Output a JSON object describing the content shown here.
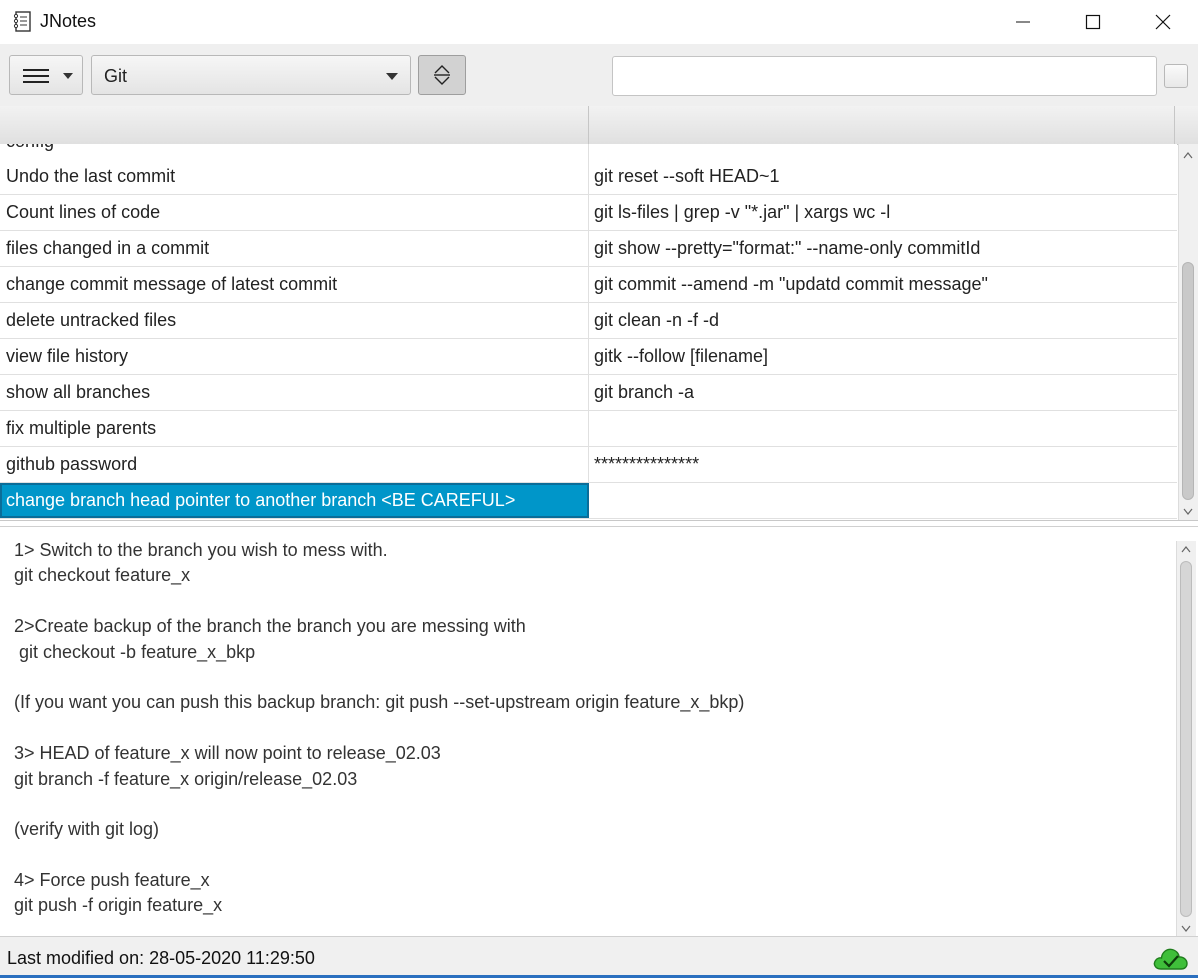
{
  "window": {
    "title": "JNotes",
    "icons": {
      "app": "notebook-icon",
      "minimize": "minimize-icon",
      "maximize": "maximize-icon",
      "close": "close-icon"
    }
  },
  "toolbar": {
    "menu_icon": "hamburger-icon",
    "category_selected": "Git",
    "expand_icon": "expand-collapse-icon",
    "search_value": "",
    "search_placeholder": ""
  },
  "table": {
    "columns": [
      "",
      ""
    ],
    "rows": [
      {
        "key": "config",
        "value": "",
        "partial": true
      },
      {
        "key": "Undo the last commit",
        "value": "git reset --soft HEAD~1"
      },
      {
        "key": "Count lines of code",
        "value": "git ls-files | grep -v \"*.jar\" | xargs wc -l"
      },
      {
        "key": "files changed in a commit",
        "value": "git show --pretty=\"format:\" --name-only commitId"
      },
      {
        "key": "change commit message of latest commit",
        "value": "git commit --amend -m \"updatd commit message\""
      },
      {
        "key": "delete untracked files",
        "value": "git clean -n -f -d"
      },
      {
        "key": "view file history",
        "value": "gitk --follow [filename]"
      },
      {
        "key": "show all branches",
        "value": "git branch -a"
      },
      {
        "key": "fix multiple parents",
        "value": ""
      },
      {
        "key": "github password",
        "value": "***************"
      },
      {
        "key": "change branch head pointer to another branch <BE CAREFUL>",
        "value": "",
        "selected": true
      }
    ]
  },
  "notes": {
    "lines": [
      "1> Switch to the branch you wish to mess with.",
      "git checkout feature_x",
      "",
      "2>Create backup of the branch the branch you are messing with",
      " git checkout -b feature_x_bkp",
      "",
      "(If you want you can push this backup branch: git push --set-upstream origin feature_x_bkp)",
      "",
      "3> HEAD of feature_x will now point to release_02.03",
      "git branch -f feature_x origin/release_02.03",
      "",
      "(verify with git log)",
      "",
      "4> Force push feature_x",
      "git push -f origin feature_x"
    ]
  },
  "status": {
    "last_modified": "Last modified on: 28-05-2020 11:29:50",
    "sync_icon": "cloud-check-icon",
    "colors": {
      "selection": "#0096c9",
      "cloud": "#3fbf3a"
    }
  }
}
